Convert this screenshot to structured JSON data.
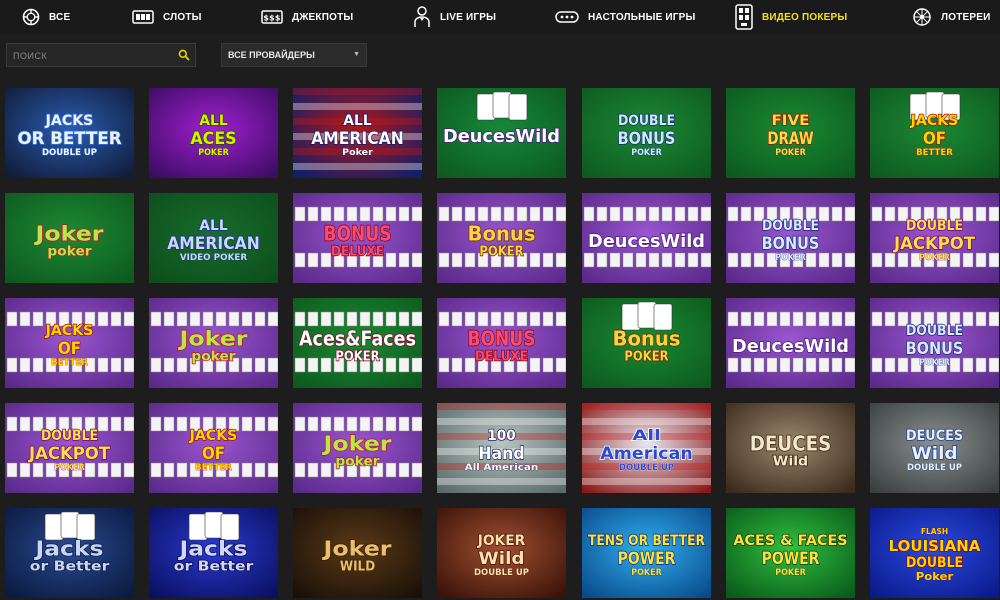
{
  "nav": {
    "items": [
      {
        "id": "all",
        "label": "ВСЕ",
        "icon": "chip-icon",
        "active": false
      },
      {
        "id": "slots",
        "label": "СЛОТЫ",
        "icon": "slot-machine-icon",
        "active": false
      },
      {
        "id": "jackpots",
        "label": "ДЖЕКПОТЫ",
        "icon": "jackpot-icon",
        "active": false
      },
      {
        "id": "live",
        "label": "LIVE ИГРЫ",
        "icon": "dealer-icon",
        "active": false
      },
      {
        "id": "table",
        "label": "НАСТОЛЬНЫЕ ИГРЫ",
        "icon": "table-icon",
        "active": false
      },
      {
        "id": "videopoker",
        "label": "ВИДЕО ПОКЕРЫ",
        "icon": "video-poker-icon",
        "active": true
      },
      {
        "id": "lottery",
        "label": "ЛОТЕРЕИ",
        "icon": "lottery-wheel-icon",
        "active": false
      }
    ]
  },
  "search": {
    "placeholder": "ПОИСК"
  },
  "provider": {
    "label": "ВСЕ ПРОВАЙДЕРЫ"
  },
  "colors": {
    "active": "#f4e20a",
    "background": "#1d1d1d"
  },
  "games": [
    {
      "lines": [
        "JACKS",
        "OR BETTER",
        "DOUBLE UP"
      ],
      "bg": "#101c3a",
      "bg2": "#2a5db0",
      "fg": "#e8f4ff",
      "stroke": "#3b6fe0",
      "style": "plain"
    },
    {
      "lines": [
        "ALL",
        "ACES",
        "POKER"
      ],
      "bg": "#3c0c62",
      "bg2": "#a020d0",
      "fg": "#d8f000",
      "stroke": "#1b4a00",
      "style": "plain"
    },
    {
      "lines": [
        "ALL",
        "AMERICAN",
        "Poker"
      ],
      "bg": "#0e1f6a",
      "bg2": "#b01818",
      "fg": "#ffffff",
      "stroke": "#0c1a7a",
      "style": "flag"
    },
    {
      "lines": [
        "DeucesWild"
      ],
      "bg": "#0d5a1f",
      "bg2": "#15893a",
      "fg": "#ffffff",
      "stroke": "#4a1a7a",
      "style": "cards"
    },
    {
      "lines": [
        "DOUBLE",
        "BONUS",
        "POKER"
      ],
      "bg": "#0e5a1e",
      "bg2": "#1c8a35",
      "fg": "#cfe8ff",
      "stroke": "#0d2d6e",
      "style": "plain"
    },
    {
      "lines": [
        "FIVE",
        "DRAW",
        "POKER"
      ],
      "bg": "#0c5a1e",
      "bg2": "#1b8a33",
      "fg": "#ffd84a",
      "stroke": "#7a2200",
      "style": "plain"
    },
    {
      "lines": [
        "JACKS",
        "OF",
        "BETTER"
      ],
      "bg": "#0d5a1e",
      "bg2": "#1c8a35",
      "fg": "#ffd400",
      "stroke": "#a01010",
      "style": "cards"
    },
    {
      "lines": [
        "Joker",
        "poker"
      ],
      "bg": "#0d5a1e",
      "bg2": "#1d8a34",
      "fg": "#b7e84a",
      "stroke": "#c4102a",
      "style": "plain"
    },
    {
      "lines": [
        "ALL",
        "AMERICAN",
        "VIDEO POKER"
      ],
      "bg": "#0d4e1c",
      "bg2": "#176d2c",
      "fg": "#c8d8ff",
      "stroke": "#1a2a88",
      "style": "plain"
    },
    {
      "lines": [
        "BONUS",
        "DELUXE"
      ],
      "bg": "#5a2a8a",
      "bg2": "#9a55d0",
      "fg": "#ff4a6a",
      "stroke": "#7a0020",
      "style": "cardrow"
    },
    {
      "lines": [
        "Bonus",
        "POKER"
      ],
      "bg": "#5a2a8a",
      "bg2": "#9a55d0",
      "fg": "#ffd040",
      "stroke": "#5a3000",
      "style": "cardrow"
    },
    {
      "lines": [
        "DeucesWild"
      ],
      "bg": "#5a2a8a",
      "bg2": "#9a55d0",
      "fg": "#ffffff",
      "stroke": "#4a1a7a",
      "style": "cardrow"
    },
    {
      "lines": [
        "DOUBLE",
        "BONUS",
        "POKER"
      ],
      "bg": "#5a2a8a",
      "bg2": "#9a55d0",
      "fg": "#d8eaff",
      "stroke": "#102a70",
      "style": "cardrow"
    },
    {
      "lines": [
        "DOUBLE",
        "JACKPOT",
        "POKER"
      ],
      "bg": "#5a2a8a",
      "bg2": "#9a55d0",
      "fg": "#ffe04a",
      "stroke": "#7a0060",
      "style": "cardrow"
    },
    {
      "lines": [
        "JACKS",
        "OF",
        "BETTER"
      ],
      "bg": "#5a2a8a",
      "bg2": "#9a55d0",
      "fg": "#ffd400",
      "stroke": "#a01010",
      "style": "cardrow"
    },
    {
      "lines": [
        "Joker",
        "poker"
      ],
      "bg": "#5a2a8a",
      "bg2": "#9a55d0",
      "fg": "#b7e84a",
      "stroke": "#c4102a",
      "style": "cardrow"
    },
    {
      "lines": [
        "Aces&Faces",
        "POKER"
      ],
      "bg": "#0d5a1e",
      "bg2": "#1b8a33",
      "fg": "#ffffff",
      "stroke": "#7a0020",
      "style": "cardrow"
    },
    {
      "lines": [
        "BONUS",
        "DELUXE"
      ],
      "bg": "#5a2a8a",
      "bg2": "#9a55d0",
      "fg": "#ff4a6a",
      "stroke": "#7a0020",
      "style": "cardrow"
    },
    {
      "lines": [
        "Bonus",
        "POKER"
      ],
      "bg": "#0d5a1e",
      "bg2": "#1b8a33",
      "fg": "#ffd040",
      "stroke": "#5a3000",
      "style": "cards"
    },
    {
      "lines": [
        "DeucesWild"
      ],
      "bg": "#5a2a8a",
      "bg2": "#9a55d0",
      "fg": "#ffffff",
      "stroke": "#4a1a7a",
      "style": "cardrow"
    },
    {
      "lines": [
        "DOUBLE",
        "BONUS",
        "POKER"
      ],
      "bg": "#5a2a8a",
      "bg2": "#9a55d0",
      "fg": "#d8eaff",
      "stroke": "#102a70",
      "style": "cardrow"
    },
    {
      "lines": [
        "DOUBLE",
        "JACKPOT",
        "POKER"
      ],
      "bg": "#5a2a8a",
      "bg2": "#9a55d0",
      "fg": "#ffe04a",
      "stroke": "#7a0060",
      "style": "cardrow"
    },
    {
      "lines": [
        "JACKS",
        "OF",
        "BETTER"
      ],
      "bg": "#5a2a8a",
      "bg2": "#9a55d0",
      "fg": "#ffd400",
      "stroke": "#a01010",
      "style": "cardrow"
    },
    {
      "lines": [
        "Joker",
        "poker"
      ],
      "bg": "#5a2a8a",
      "bg2": "#9a55d0",
      "fg": "#b7e84a",
      "stroke": "#c4102a",
      "style": "cardrow"
    },
    {
      "lines": [
        "100",
        "Hand",
        "All American"
      ],
      "bg": "#5a6a6a",
      "bg2": "#b8c4c0",
      "fg": "#ffffff",
      "stroke": "#1a2a6a",
      "style": "flag"
    },
    {
      "lines": [
        "All",
        "American",
        "DOUBLE UP"
      ],
      "bg": "#8a1818",
      "bg2": "#e8e8f0",
      "fg": "#2a4ad0",
      "stroke": "#ffffff",
      "style": "flag"
    },
    {
      "lines": [
        "DEUCES",
        "Wild"
      ],
      "bg": "#3a2a1a",
      "bg2": "#9a8a70",
      "fg": "#f0e8d0",
      "stroke": "#3a1a00",
      "style": "plain"
    },
    {
      "lines": [
        "DEUCES",
        "Wild",
        "DOUBLE UP"
      ],
      "bg": "#3a4040",
      "bg2": "#8a9090",
      "fg": "#e8f0ff",
      "stroke": "#1a3a8a",
      "style": "plain"
    },
    {
      "lines": [
        "Jacks",
        "or Better"
      ],
      "bg": "#0a1a40",
      "bg2": "#2a4a90",
      "fg": "#c8d8f0",
      "stroke": "#0a1a50",
      "style": "cards"
    },
    {
      "lines": [
        "Jacks",
        "or Better"
      ],
      "bg": "#0a1060",
      "bg2": "#2a3ad0",
      "fg": "#d0d8ff",
      "stroke": "#0a0a50",
      "style": "cards"
    },
    {
      "lines": [
        "Joker",
        "WILD"
      ],
      "bg": "#1a1008",
      "bg2": "#5a3a18",
      "fg": "#e8c070",
      "stroke": "#3a2000",
      "style": "plain"
    },
    {
      "lines": [
        "JOKER",
        "Wild",
        "DOUBLE UP"
      ],
      "bg": "#3a1208",
      "bg2": "#a05030",
      "fg": "#f8e0b0",
      "stroke": "#4a1000",
      "style": "plain"
    },
    {
      "lines": [
        "TENS OR BETTER",
        "POWER",
        "POKER"
      ],
      "bg": "#0a4a8a",
      "bg2": "#30b0f0",
      "fg": "#ffe040",
      "stroke": "#0a2a6a",
      "style": "plain"
    },
    {
      "lines": [
        "ACES & FACES",
        "POWER",
        "POKER"
      ],
      "bg": "#0a5a1a",
      "bg2": "#30c040",
      "fg": "#ffe040",
      "stroke": "#0a3a0a",
      "style": "plain"
    },
    {
      "lines": [
        "FLASH",
        "LOUISIANA",
        "DOUBLE",
        "Poker"
      ],
      "bg": "#0a1a8a",
      "bg2": "#2a4ae0",
      "fg": "#ffd400",
      "stroke": "#8a0010",
      "style": "plain"
    }
  ]
}
